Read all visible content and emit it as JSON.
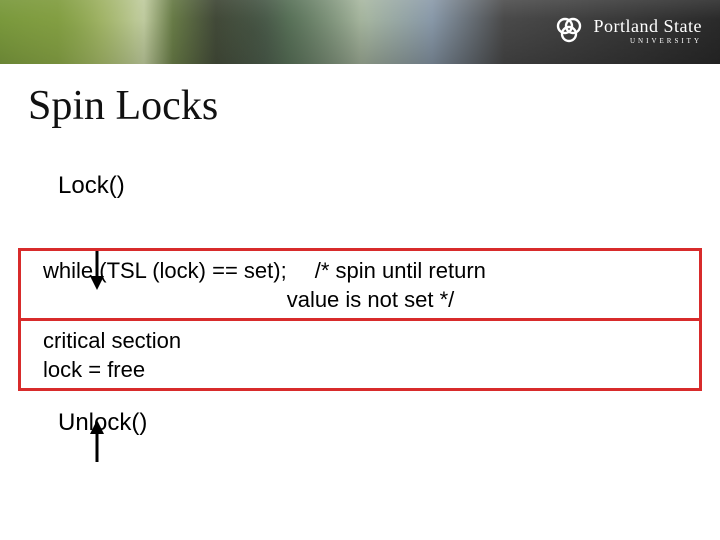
{
  "university": {
    "name": "Portland State",
    "sub": "UNIVERSITY"
  },
  "title": "Spin Locks",
  "labels": {
    "lock": "Lock()",
    "unlock": "Unlock()"
  },
  "box1": {
    "code": "while (TSL (lock) == set);",
    "comment_l1": "/* spin until return",
    "comment_l2": "value is not set */"
  },
  "box2": {
    "line1": "critical section",
    "line2": "lock = free"
  }
}
